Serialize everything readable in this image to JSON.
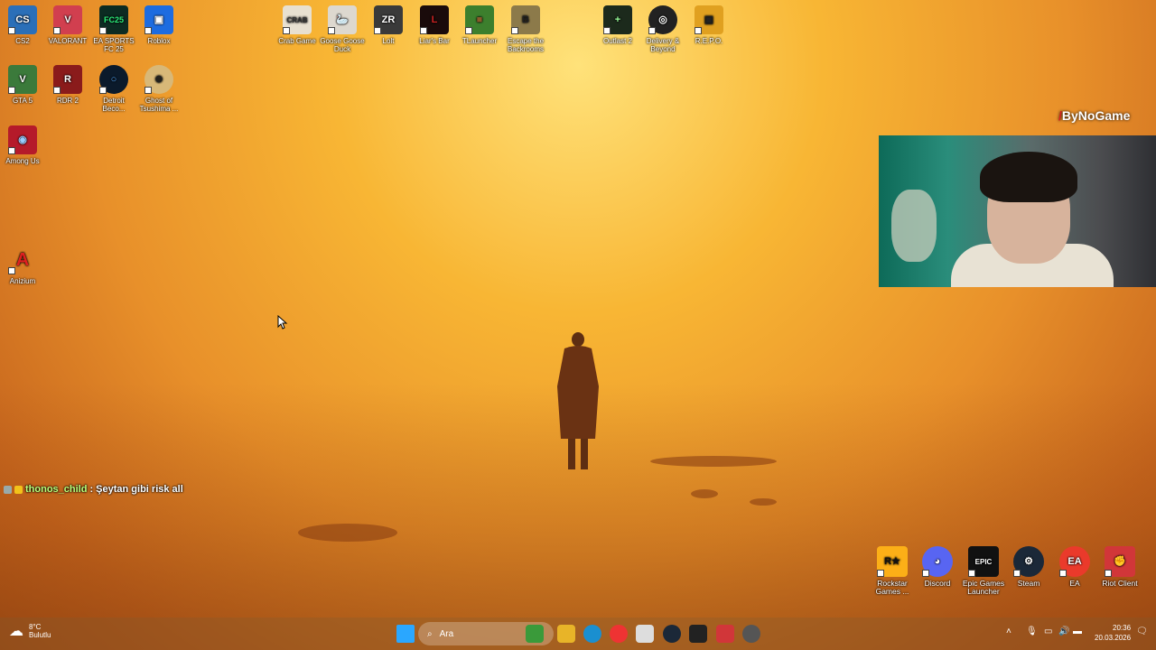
{
  "desktop_icons": [
    {
      "label": "CS2",
      "color": "#2b6fb8",
      "glyph": "CS"
    },
    {
      "label": "VALORANT",
      "color": "#d13f4f",
      "glyph": "V"
    },
    {
      "label": "EA SPORTS FC 25",
      "color": "#0c2b22",
      "glyph": "FC25"
    },
    {
      "label": "Roblox",
      "color": "#1d6ce0",
      "glyph": "▣"
    },
    {
      "label": "Crab Game",
      "color": "#e8e0d0",
      "glyph": "CRAB"
    },
    {
      "label": "Goose Goose Duck",
      "color": "#ddd8cf",
      "glyph": "🦢"
    },
    {
      "label": "Lolt",
      "color": "#3a3a3a",
      "glyph": "ZR"
    },
    {
      "label": "Liar's Bar",
      "color": "#1a0b0b",
      "glyph": "L"
    },
    {
      "label": "TLauncher",
      "color": "#3c7f2d",
      "glyph": "■"
    },
    {
      "label": "Escape the Backrooms",
      "color": "#8c7a4a",
      "glyph": "B"
    },
    {
      "label": "Outlast 2",
      "color": "#1c2a1c",
      "glyph": "+"
    },
    {
      "label": "Delivery & Beyond",
      "color": "#222",
      "glyph": "◎"
    },
    {
      "label": "R.E.P.O.",
      "color": "#e0a020",
      "glyph": "▣"
    },
    {
      "label": "GTA 5",
      "color": "#3b7a3b",
      "glyph": "V"
    },
    {
      "label": "RDR 2",
      "color": "#8a1b1b",
      "glyph": "R"
    },
    {
      "label": "Detroit Beco...",
      "color": "#0b1a2b",
      "glyph": "○"
    },
    {
      "label": "Ghost of Tsushima ...",
      "color": "#d8b878",
      "glyph": "⊜"
    },
    {
      "label": "Among Us",
      "color": "#b51a2a",
      "glyph": "◉"
    },
    {
      "label": "Anizium",
      "color": "#f2f2f2",
      "glyph": "A"
    }
  ],
  "launchers": [
    {
      "label": "Rockstar Games ...",
      "color": "#fcaf17",
      "glyph": "R★"
    },
    {
      "label": "Discord",
      "color": "#5865f2",
      "glyph": "◕"
    },
    {
      "label": "Epic Games Launcher",
      "color": "#111",
      "glyph": "EPIC"
    },
    {
      "label": "Steam",
      "color": "#1b2838",
      "glyph": "⚙"
    },
    {
      "label": "EA",
      "color": "#ea3a2b",
      "glyph": "EA"
    },
    {
      "label": "Riot Client",
      "color": "#d13639",
      "glyph": "✊"
    }
  ],
  "brand": {
    "slash": "/",
    "name": "ByNoGame"
  },
  "chat": {
    "user": "thonos_child",
    "message": ": Şeytan gibi risk all"
  },
  "taskbar": {
    "search_placeholder": "Ara",
    "weather_temp": "8°C",
    "weather_desc": "Bulutlu",
    "time": "20:36",
    "date": "20.03.2026"
  }
}
